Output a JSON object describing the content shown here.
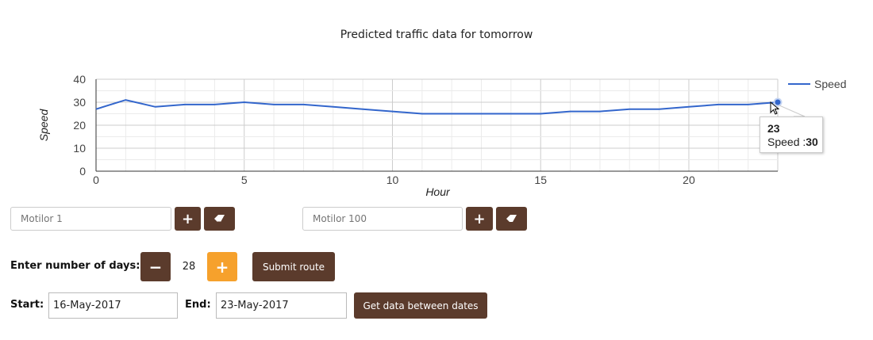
{
  "chart_data": {
    "type": "line",
    "title": "Predicted traffic data for tomorrow",
    "xlabel": "Hour",
    "ylabel": "Speed",
    "xlim": [
      0,
      23
    ],
    "ylim": [
      0,
      40
    ],
    "x_ticks": [
      0,
      5,
      10,
      15,
      20
    ],
    "y_ticks": [
      0,
      10,
      20,
      30,
      40
    ],
    "grid": true,
    "legend_position": "top-right",
    "series": [
      {
        "name": "Speed",
        "color": "#3366cc",
        "x": [
          0,
          1,
          2,
          3,
          4,
          5,
          6,
          7,
          8,
          9,
          10,
          11,
          12,
          13,
          14,
          15,
          16,
          17,
          18,
          19,
          20,
          21,
          22,
          23
        ],
        "values": [
          27,
          31,
          28,
          29,
          29,
          30,
          29,
          29,
          28,
          27,
          26,
          25,
          25,
          25,
          25,
          25,
          26,
          26,
          27,
          27,
          28,
          29,
          29,
          30
        ]
      }
    ],
    "tooltip": {
      "x": "23",
      "series_label": "Speed :",
      "value": "30"
    }
  },
  "route": {
    "input1": {
      "placeholder": "Motilor 1"
    },
    "input2": {
      "placeholder": "Motilor 100"
    },
    "add_icon": "+",
    "erase_icon": "eraser-icon"
  },
  "days": {
    "label": "Enter number of days:",
    "minus_icon": "−",
    "value": "28",
    "plus_icon": "+",
    "submit_label": "Submit route"
  },
  "dates": {
    "start_label": "Start:",
    "start_value": "16-May-2017",
    "end_label": "End:",
    "end_value": "23-May-2017",
    "get_label": "Get data between dates"
  },
  "colors": {
    "button_brown": "#5b3b2c",
    "button_orange": "#f6a12c",
    "series_blue": "#3366cc"
  }
}
